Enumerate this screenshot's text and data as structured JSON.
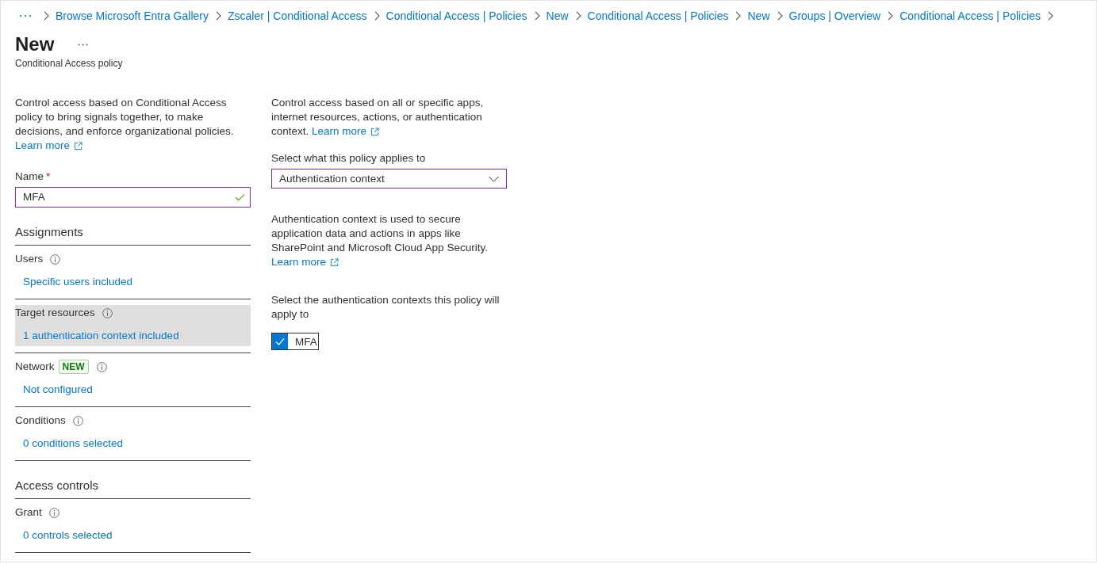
{
  "breadcrumb": [
    "Browse Microsoft Entra Gallery",
    "Zscaler | Conditional Access",
    "Conditional Access | Policies",
    "New",
    "Conditional Access | Policies",
    "New",
    "Groups | Overview",
    "Conditional Access | Policies"
  ],
  "header": {
    "title": "New",
    "subtitle": "Conditional Access policy"
  },
  "left_panel": {
    "description": "Control access based on Conditional Access policy to bring signals together, to make decisions, and enforce organizational policies.",
    "learn_more": "Learn more",
    "name_field": {
      "label": "Name",
      "required_mark": "*",
      "value": "MFA",
      "valid": true
    },
    "sections": [
      {
        "heading": "Assignments",
        "items": [
          {
            "label": "Users",
            "value": "Specific users included",
            "selected": false
          },
          {
            "label": "Target resources",
            "value": "1 authentication context included",
            "selected": true
          },
          {
            "label": "Network",
            "badge": "NEW",
            "value": "Not configured",
            "selected": false
          },
          {
            "label": "Conditions",
            "value": "0 conditions selected",
            "selected": false
          }
        ]
      },
      {
        "heading": "Access controls",
        "items": [
          {
            "label": "Grant",
            "value": "0 controls selected",
            "selected": false
          }
        ]
      }
    ]
  },
  "right_panel": {
    "description": "Control access based on all or specific apps, internet resources, actions, or authentication context.",
    "learn_more": "Learn more",
    "applies_to": {
      "label": "Select what this policy applies to",
      "value": "Authentication context"
    },
    "context_description": "Authentication context is used to secure application data and actions in apps like SharePoint and Microsoft Cloud App Security.",
    "context_learn_more": "Learn more",
    "contexts_label": "Select the authentication contexts this policy will apply to",
    "contexts": [
      {
        "label": "MFA",
        "checked": true
      }
    ]
  }
}
